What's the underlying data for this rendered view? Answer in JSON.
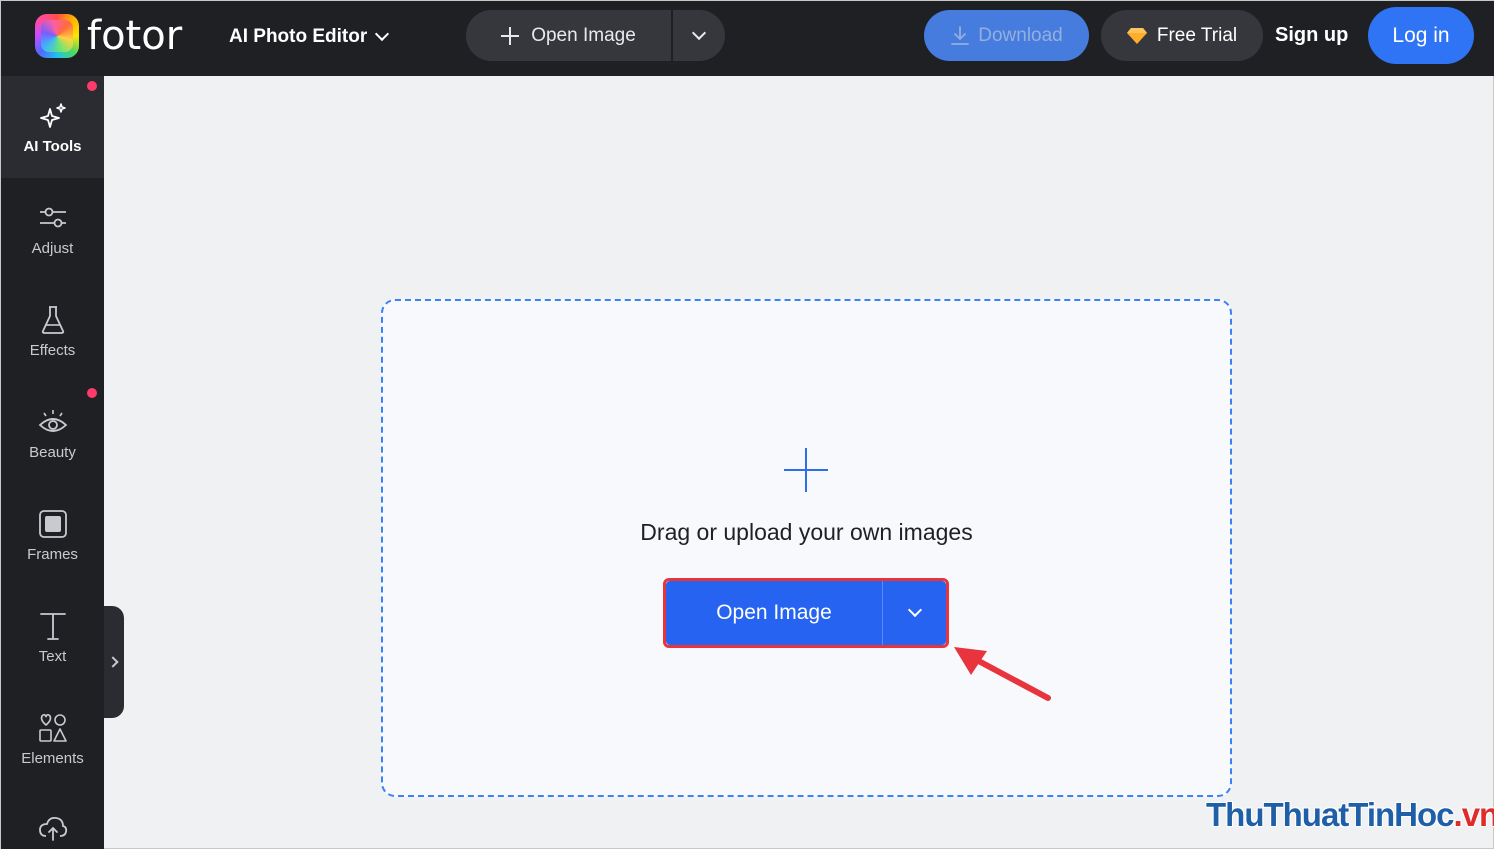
{
  "header": {
    "logo_text": "fotor",
    "product_label": "AI Photo Editor",
    "open_image_label": "Open Image",
    "download_label": "Download",
    "free_trial_label": "Free Trial",
    "signup_label": "Sign up",
    "login_label": "Log in"
  },
  "sidebar": {
    "items": [
      {
        "label": "AI Tools",
        "icon": "sparkle-icon",
        "active": true,
        "badge": true
      },
      {
        "label": "Adjust",
        "icon": "sliders-icon",
        "active": false,
        "badge": false
      },
      {
        "label": "Effects",
        "icon": "flask-icon",
        "active": false,
        "badge": false
      },
      {
        "label": "Beauty",
        "icon": "eye-icon",
        "active": false,
        "badge": true
      },
      {
        "label": "Frames",
        "icon": "frame-icon",
        "active": false,
        "badge": false
      },
      {
        "label": "Text",
        "icon": "text-icon",
        "active": false,
        "badge": false
      },
      {
        "label": "Elements",
        "icon": "shapes-icon",
        "active": false,
        "badge": false
      }
    ]
  },
  "canvas": {
    "drag_text": "Drag or upload your own images",
    "open_image_label": "Open Image"
  },
  "watermark": {
    "main": "ThuThuatTinHoc",
    "tail": ".vn"
  },
  "colors": {
    "accent": "#2563f0",
    "highlight": "#e8343d",
    "badge": "#ff3b6b",
    "topbar": "#1f2024"
  }
}
